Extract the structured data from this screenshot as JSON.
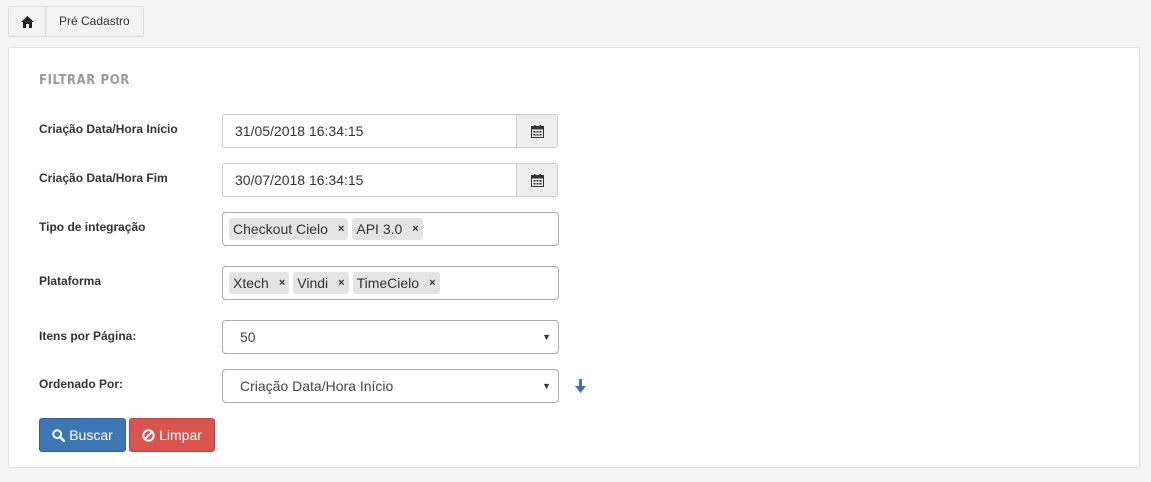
{
  "breadcrumb": {
    "home_icon": "home-icon",
    "current": "Pré Cadastro"
  },
  "panel": {
    "title": "FILTRAR POR"
  },
  "filters": {
    "start": {
      "label": "Criação Data/Hora Início",
      "value": "31/05/2018 16:34:15",
      "icon": "calendar-icon"
    },
    "end": {
      "label": "Criação Data/Hora Fim",
      "value": "30/07/2018 16:34:15",
      "icon": "calendar-icon"
    },
    "integration": {
      "label": "Tipo de integração",
      "tags": [
        "Checkout Cielo",
        "API 3.0"
      ]
    },
    "platform": {
      "label": "Plataforma",
      "tags": [
        "Xtech",
        "Vindi",
        "TimeCielo"
      ]
    },
    "per_page": {
      "label": "Itens por Página:",
      "value": "50"
    },
    "order_by": {
      "label": "Ordenado Por:",
      "value": "Criação Data/Hora Início",
      "sort_icon": "arrow-down-icon"
    }
  },
  "tag_remove": "×",
  "buttons": {
    "search": "Buscar",
    "clear": "Limpar"
  },
  "colors": {
    "primary": "#3c76b4",
    "danger": "#d9534f",
    "sort_arrow": "#3c76b4"
  }
}
